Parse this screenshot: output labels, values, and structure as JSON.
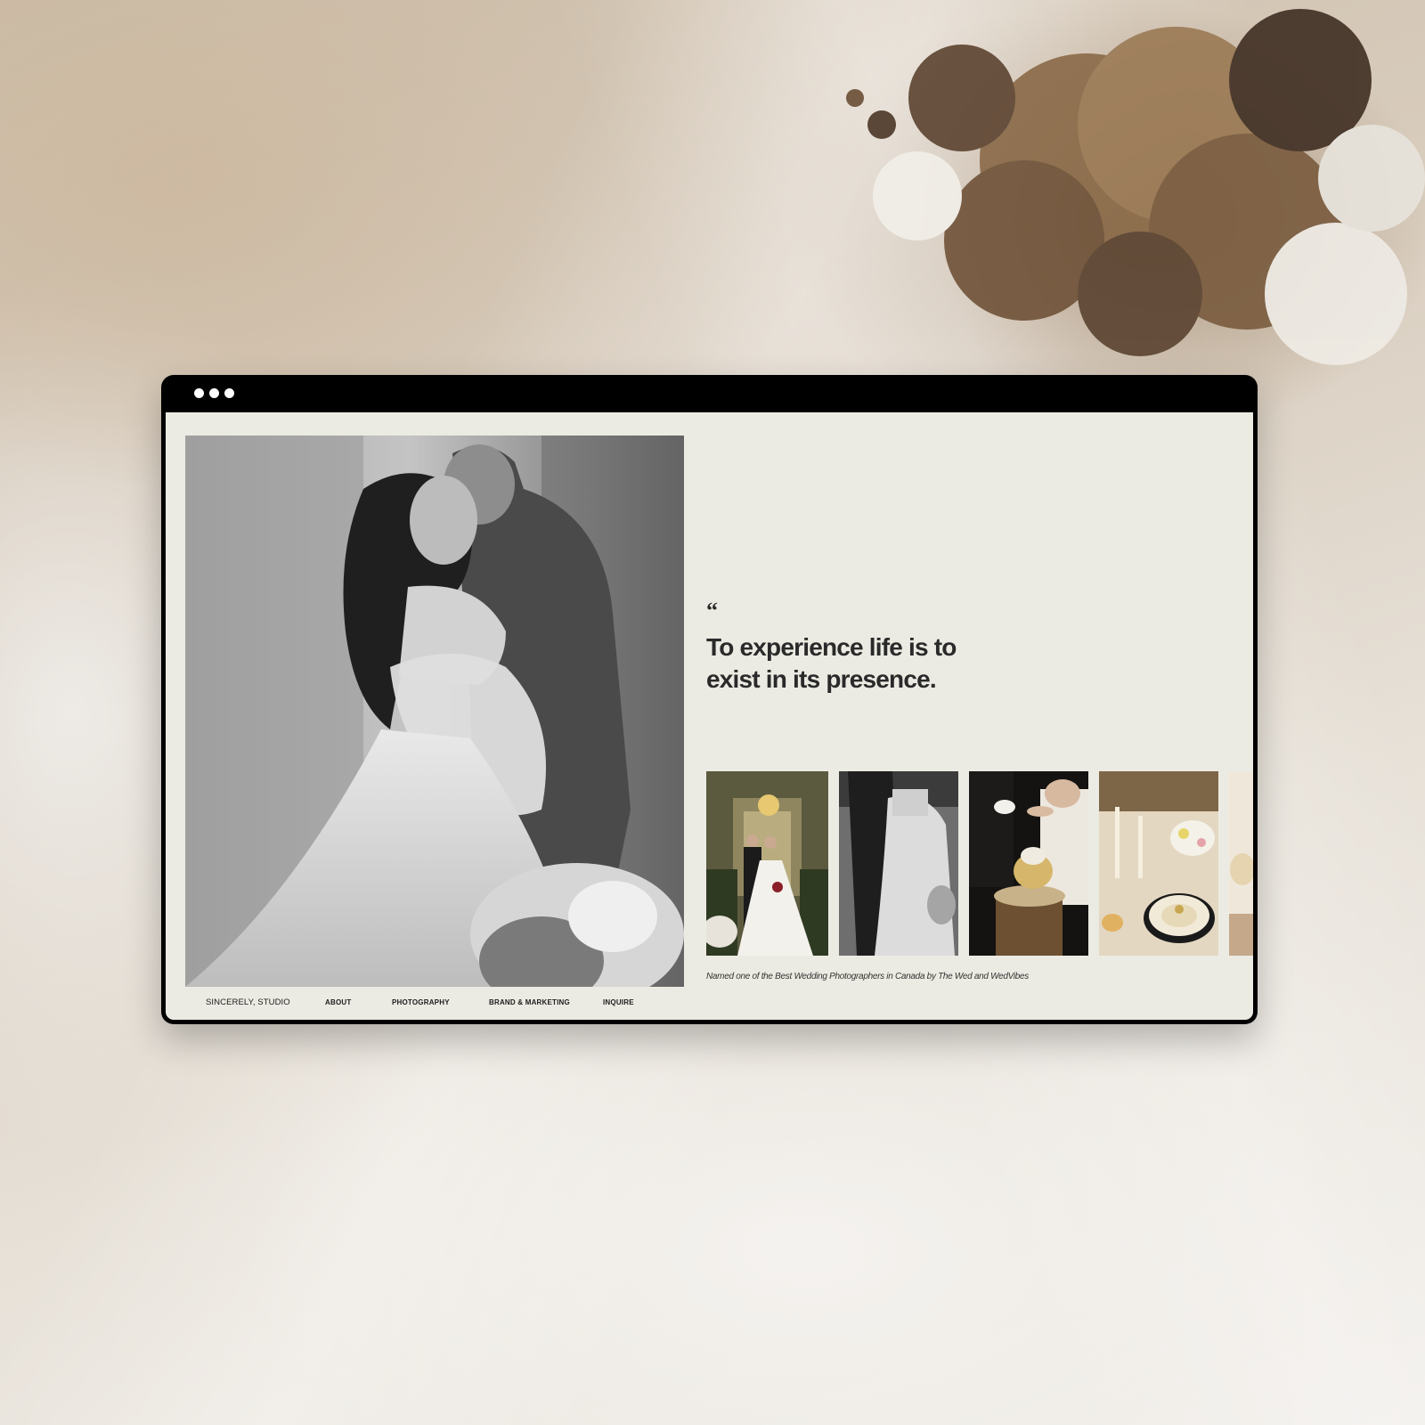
{
  "window": {
    "dots": [
      "dot",
      "dot",
      "dot"
    ]
  },
  "hero": {
    "image_description": "black-and-white photo"
  },
  "quote": {
    "mark": "“",
    "line1": "To experience life is to",
    "line2": "exist in its presence."
  },
  "gallery": {
    "thumbnails": [
      {
        "name": "gallery-thumb-1"
      },
      {
        "name": "gallery-thumb-2"
      },
      {
        "name": "gallery-thumb-3"
      },
      {
        "name": "gallery-thumb-4"
      },
      {
        "name": "gallery-thumb-5"
      }
    ],
    "caption": "Named one of the Best Wedding Photographers in Canada by The Wed and WedVibes"
  },
  "nav": {
    "brand": "SINCERELY, STUDIO",
    "items": [
      "ABOUT",
      "PHOTOGRAPHY",
      "BRAND & MARKETING",
      "INQUIRE"
    ]
  },
  "colors": {
    "page_background": "#ecebe3",
    "window_frame": "#000000",
    "text": "#2a2a2a"
  }
}
